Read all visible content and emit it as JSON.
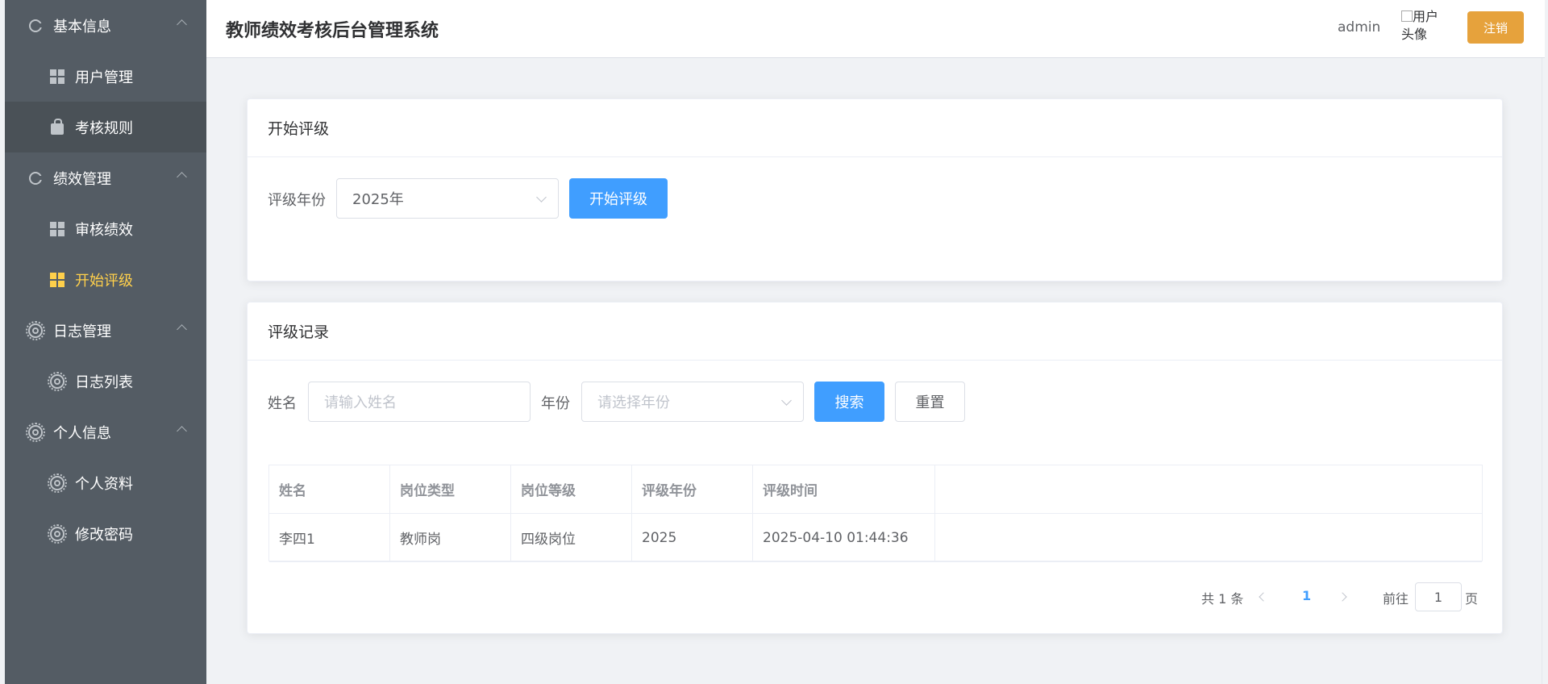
{
  "header": {
    "title": "教师绩效考核后台管理系统",
    "username": "admin",
    "avatar_alt": "用户头像",
    "logout_label": "注销"
  },
  "sidebar": {
    "groups": [
      {
        "label": "基本信息",
        "items": [
          {
            "label": "用户管理"
          },
          {
            "label": "考核规则"
          }
        ]
      },
      {
        "label": "绩效管理",
        "items": [
          {
            "label": "审核绩效"
          },
          {
            "label": "开始评级"
          }
        ]
      },
      {
        "label": "日志管理",
        "items": [
          {
            "label": "日志列表"
          }
        ]
      },
      {
        "label": "个人信息",
        "items": [
          {
            "label": "个人资料"
          },
          {
            "label": "修改密码"
          }
        ]
      }
    ],
    "active_item": "开始评级",
    "active_color": "#ffd04b",
    "background": "#545c64"
  },
  "rating_card": {
    "title": "开始评级",
    "year_label": "评级年份",
    "year_value": "2025年",
    "start_button": "开始评级"
  },
  "records_card": {
    "title": "评级记录",
    "name_label": "姓名",
    "name_placeholder": "请输入姓名",
    "year_label": "年份",
    "year_placeholder": "请选择年份",
    "search_button": "搜索",
    "reset_button": "重置",
    "table": {
      "columns": [
        "姓名",
        "岗位类型",
        "岗位等级",
        "评级年份",
        "评级时间"
      ],
      "rows": [
        [
          "李四1",
          "教师岗",
          "四级岗位",
          "2025",
          "2025-04-10 01:44:36"
        ]
      ]
    },
    "pagination": {
      "total_text": "共 1 条",
      "current_page": "1",
      "goto_label": "前往",
      "goto_value": "1",
      "page_suffix": "页"
    }
  },
  "colors": {
    "primary": "#409eff",
    "warning": "#e6a23c"
  }
}
